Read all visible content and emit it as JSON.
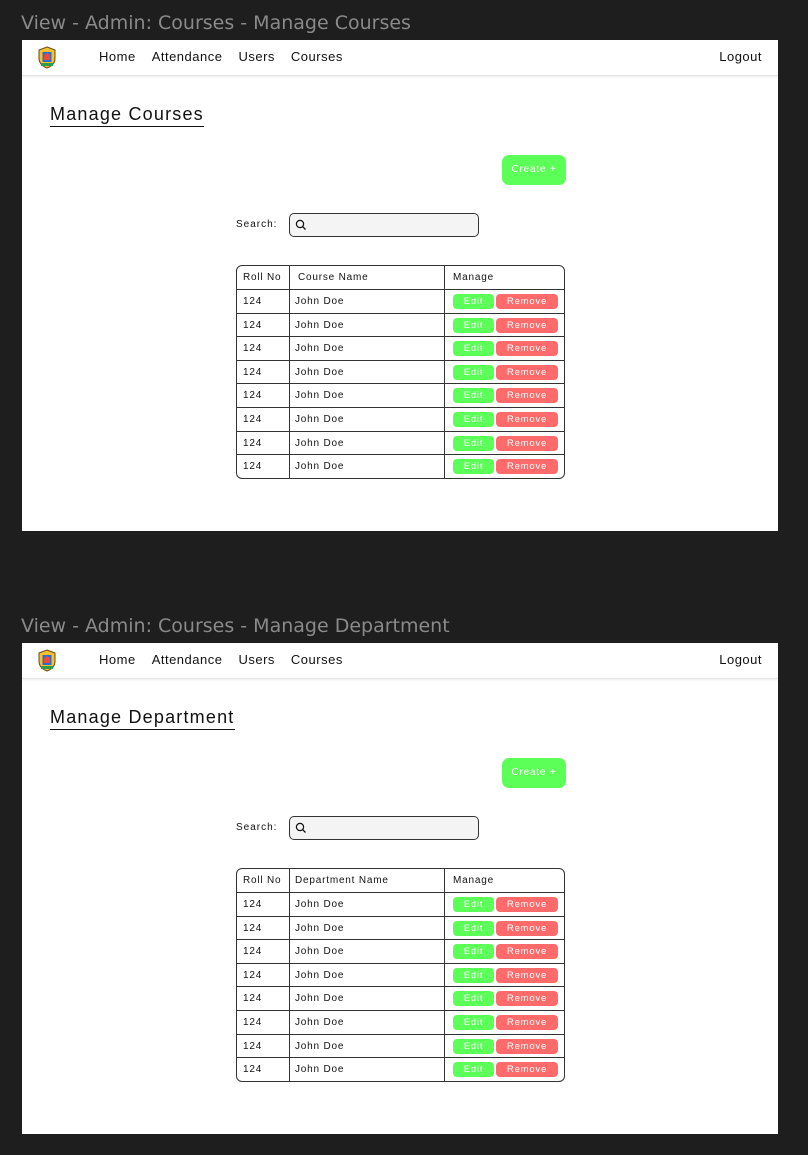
{
  "frames": [
    {
      "label": "View - Admin: Courses - Manage Courses",
      "nav": {
        "items": [
          "Home",
          "Attendance",
          "Users",
          "Courses"
        ],
        "logout": "Logout"
      },
      "title": "Manage Courses",
      "create_label": "Create +",
      "search": {
        "label": "Search:",
        "value": ""
      },
      "table": {
        "headers": [
          "Roll No",
          "Course Name",
          "Manage"
        ],
        "rows": [
          {
            "roll": "124",
            "name": "John Doe"
          },
          {
            "roll": "124",
            "name": "John Doe"
          },
          {
            "roll": "124",
            "name": "John Doe"
          },
          {
            "roll": "124",
            "name": "John Doe"
          },
          {
            "roll": "124",
            "name": "John Doe"
          },
          {
            "roll": "124",
            "name": "John Doe"
          },
          {
            "roll": "124",
            "name": "John Doe"
          },
          {
            "roll": "124",
            "name": "John Doe"
          }
        ],
        "edit_label": "Edit",
        "remove_label": "Remove"
      }
    },
    {
      "label": "View - Admin: Courses - Manage Department",
      "nav": {
        "items": [
          "Home",
          "Attendance",
          "Users",
          "Courses"
        ],
        "logout": "Logout"
      },
      "title": "Manage Department",
      "create_label": "Create +",
      "search": {
        "label": "Search:",
        "value": ""
      },
      "table": {
        "headers": [
          "Roll No",
          "Department Name",
          "Manage"
        ],
        "rows": [
          {
            "roll": "124",
            "name": "John Doe"
          },
          {
            "roll": "124",
            "name": "John Doe"
          },
          {
            "roll": "124",
            "name": "John Doe"
          },
          {
            "roll": "124",
            "name": "John Doe"
          },
          {
            "roll": "124",
            "name": "John Doe"
          },
          {
            "roll": "124",
            "name": "John Doe"
          },
          {
            "roll": "124",
            "name": "John Doe"
          },
          {
            "roll": "124",
            "name": "John Doe"
          }
        ],
        "edit_label": "Edit",
        "remove_label": "Remove"
      }
    }
  ],
  "colors": {
    "canvas": "#1e1e1e",
    "create": "#5cff57",
    "edit": "#5cff57",
    "remove": "#ff6b6b"
  },
  "icons": {
    "logo": "university-crest-icon",
    "search": "search-icon"
  }
}
